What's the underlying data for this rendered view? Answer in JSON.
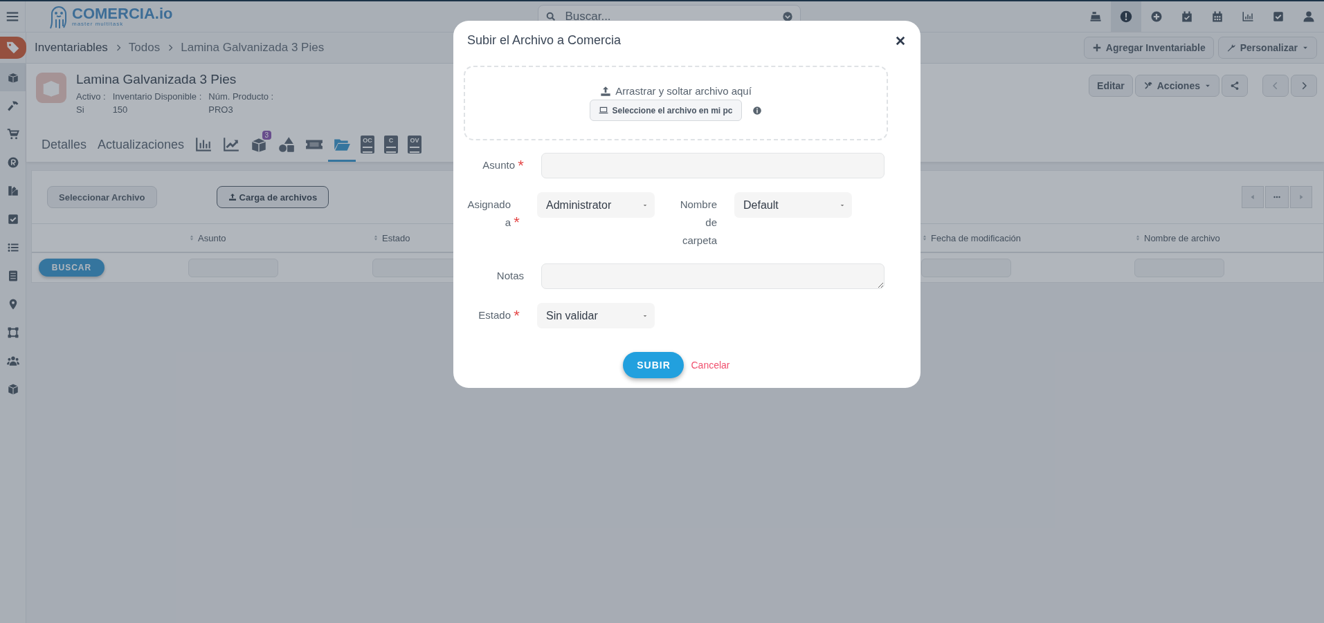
{
  "top_bar": {
    "logo": {
      "name": "COMERCIA.io",
      "tagline": "master multitask"
    },
    "search": {
      "placeholder": "Buscar..."
    },
    "icons": [
      {
        "kind": "register",
        "selected": false
      },
      {
        "kind": "alert",
        "selected": true
      },
      {
        "kind": "plus",
        "selected": false
      },
      {
        "kind": "calendar-check",
        "selected": false
      },
      {
        "kind": "calendar",
        "selected": false
      },
      {
        "kind": "chart",
        "selected": false
      },
      {
        "kind": "check",
        "selected": false
      },
      {
        "kind": "user",
        "selected": false
      }
    ]
  },
  "sidebar": {
    "items": [
      {
        "kind": "box",
        "selected": true
      },
      {
        "kind": "hammer",
        "selected": false
      },
      {
        "kind": "cart",
        "selected": false
      },
      {
        "kind": "r",
        "selected": false
      },
      {
        "kind": "swatch",
        "selected": false
      },
      {
        "kind": "check",
        "selected": false
      },
      {
        "kind": "list",
        "selected": false
      },
      {
        "kind": "cabinet",
        "selected": false
      },
      {
        "kind": "pin",
        "selected": false
      },
      {
        "kind": "vector",
        "selected": false
      },
      {
        "kind": "users",
        "selected": false
      },
      {
        "kind": "cube",
        "selected": false
      }
    ]
  },
  "breadcrumb": {
    "items": [
      "Inventariables",
      "Todos",
      "Lamina Galvanizada 3 Pies"
    ],
    "actions": [
      {
        "kind": "add",
        "label": "Agregar Inventariable"
      },
      {
        "kind": "customize",
        "label": "Personalizar"
      }
    ]
  },
  "record": {
    "title": "Lamina Galvanizada 3 Pies",
    "fields": [
      {
        "label": "Activo :",
        "value": "Si"
      },
      {
        "label": "Inventario Disponible :",
        "value": "150"
      },
      {
        "label": "Núm. Producto :",
        "value": "PRO3"
      }
    ],
    "buttons": [
      {
        "kind": "edit",
        "label": "Editar"
      },
      {
        "kind": "actions",
        "label": "Acciones"
      },
      {
        "kind": "share"
      }
    ]
  },
  "tabs": [
    {
      "kind": "text",
      "label": "Detalles",
      "selected": false
    },
    {
      "kind": "text",
      "label": "Actualizaciones",
      "selected": false
    },
    {
      "kind": "bar-chart",
      "selected": false
    },
    {
      "kind": "line-chart",
      "selected": false
    },
    {
      "kind": "box",
      "badge": "3",
      "selected": false
    },
    {
      "kind": "shapes",
      "selected": false
    },
    {
      "kind": "ticket",
      "selected": false
    },
    {
      "kind": "folder",
      "selected": true
    },
    {
      "kind": "doc",
      "doc_label": "OC",
      "selected": false
    },
    {
      "kind": "doc",
      "doc_label": "C",
      "selected": false
    },
    {
      "kind": "doc",
      "doc_label": "OV",
      "selected": false
    }
  ],
  "toolbar": {
    "buttons": [
      {
        "kind": "plain",
        "label": "Seleccionar Archivo"
      },
      {
        "kind": "upload",
        "label": "Carga de archivos"
      }
    ]
  },
  "table": {
    "columns": [
      {
        "label": "Asunto"
      },
      {
        "label": "Estado"
      },
      {
        "label": "Fecha de modificación"
      },
      {
        "label": "Nombre de archivo"
      }
    ],
    "search_button": "BUSCAR"
  },
  "modal": {
    "title": "Subir el Archivo a Comercia",
    "dropzone": {
      "text": "Arrastrar y soltar archivo aquí",
      "button": "Seleccione el archivo en mi pc"
    },
    "rows": [
      [
        {
          "label": "Asunto",
          "required": true,
          "kind": "text"
        }
      ],
      [
        {
          "label": "Asignado a",
          "required": true,
          "kind": "select",
          "value": "Administrator"
        },
        {
          "label": "Nombre de carpeta",
          "required": false,
          "kind": "select",
          "value": "Default"
        }
      ],
      [
        {
          "label": "Notas",
          "required": false,
          "kind": "textarea"
        }
      ],
      [
        {
          "label": "Estado",
          "required": true,
          "kind": "select",
          "value": "Sin validar"
        }
      ]
    ],
    "submit": "SUBIR",
    "cancel": "Cancelar"
  }
}
